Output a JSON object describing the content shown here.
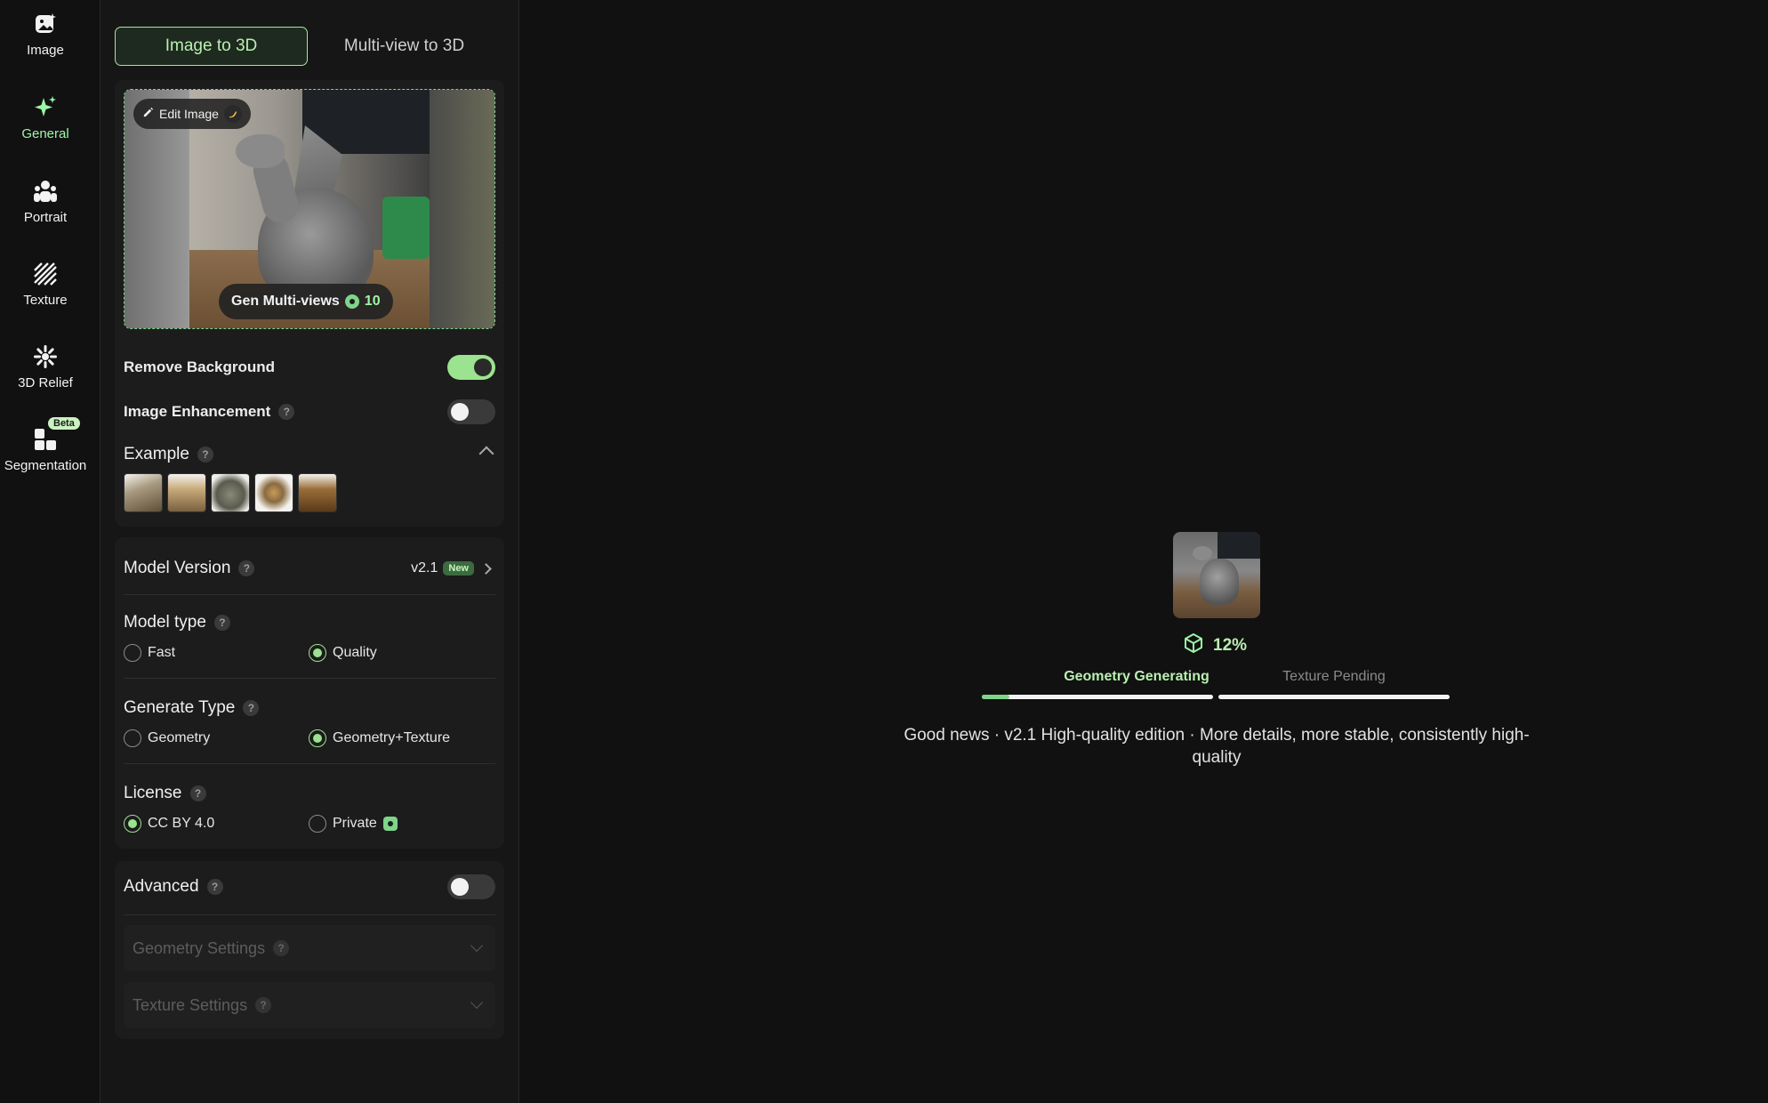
{
  "rail": {
    "items": [
      {
        "label": "Image",
        "icon": "image-icon"
      },
      {
        "label": "General",
        "icon": "sparkle-icon",
        "active": true
      },
      {
        "label": "Portrait",
        "icon": "portrait-icon"
      },
      {
        "label": "Texture",
        "icon": "texture-icon"
      },
      {
        "label": "3D Relief",
        "icon": "relief-icon"
      },
      {
        "label": "Segmentation",
        "icon": "segmentation-icon",
        "badge": "Beta"
      }
    ]
  },
  "tabs": {
    "image_to_3d": "Image to 3D",
    "multiview_to_3d": "Multi-view to 3D"
  },
  "upload": {
    "edit_label": "Edit Image",
    "gen_multiviews_label": "Gen Multi-views",
    "gen_multiviews_cost": "10"
  },
  "options": {
    "remove_background": {
      "label": "Remove Background",
      "on": true
    },
    "image_enhancement": {
      "label": "Image Enhancement",
      "on": false
    }
  },
  "examples": {
    "title": "Example",
    "count": 5
  },
  "model_version": {
    "label": "Model Version",
    "value": "v2.1",
    "badge": "New"
  },
  "model_type": {
    "label": "Model type",
    "options": [
      "Fast",
      "Quality"
    ],
    "selected": "Quality"
  },
  "generate_type": {
    "label": "Generate Type",
    "options": [
      "Geometry",
      "Geometry+Texture"
    ],
    "selected": "Geometry+Texture"
  },
  "license": {
    "label": "License",
    "options": [
      "CC BY 4.0",
      "Private"
    ],
    "selected": "CC BY 4.0"
  },
  "advanced": {
    "label": "Advanced",
    "on": false,
    "geometry_settings": "Geometry Settings",
    "texture_settings": "Texture Settings"
  },
  "progress": {
    "percent_label": "12%",
    "percent": 12,
    "geometry_stage": "Geometry Generating",
    "texture_stage": "Texture Pending",
    "news": "Good news · v2.1 High-quality edition · More details, more stable, consistently high-quality"
  },
  "colors": {
    "accent": "#9be38f",
    "background": "#111111",
    "panel": "#1c1c1c"
  }
}
